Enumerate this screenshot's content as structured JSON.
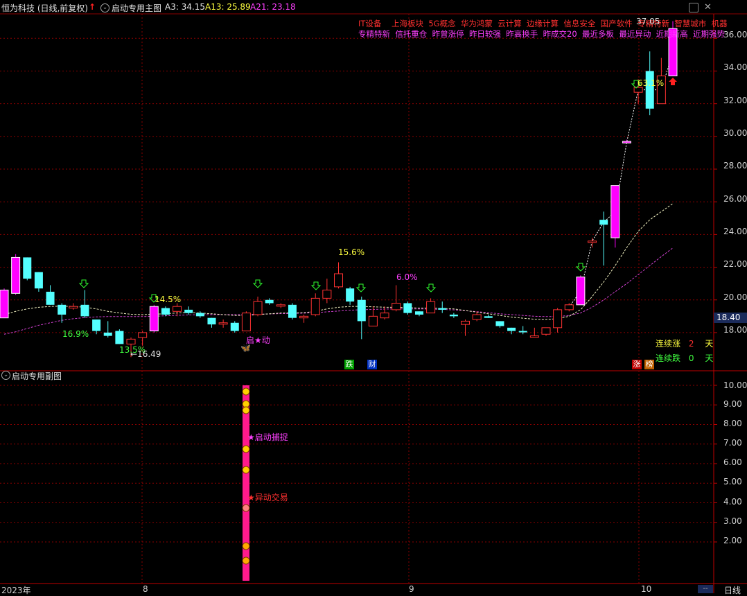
{
  "header": {
    "stock_title": "恒为科技 (日线,前复权)",
    "main_indicator": "启动专用主图",
    "a3_label": "A3: 34.15",
    "a13_label": "A13: 25.89",
    "a21_label": "A21: 23.18",
    "up_arrow": "↑",
    "collapse_glyph": "⌄"
  },
  "concept_tags": {
    "row1": [
      "IT设备",
      "上海板块",
      "5G概念",
      "华为鸿蒙",
      "云计算",
      "边缘计算",
      "信息安全",
      "国产软件",
      "专精特新",
      "智慧城市",
      "机器"
    ],
    "row2": [
      "专精特新",
      "信托重仓",
      "昨曾涨停",
      "昨日较强",
      "昨高换手",
      "昨成交20",
      "最近多板",
      "最近异动",
      "近期新高",
      "近期强势"
    ]
  },
  "chart_annotations": {
    "high_label": "37.05",
    "pct_labels": [
      "16.9%",
      "13.5%",
      "14.5%",
      "15.6%",
      "6.0%",
      "63.1%"
    ],
    "low_label": "←16.49",
    "start_label": "启★动",
    "die_label": "跌",
    "cai_label": "财",
    "zhang_label": "涨",
    "bang_label": "榜",
    "price_badge": "18.40"
  },
  "streak": {
    "up_label": "连续涨",
    "up_value": "2",
    "down_label": "连续跌",
    "down_value": "0",
    "unit": "天"
  },
  "sub_panel": {
    "title": "启动专用副图",
    "signal1": "★启动捕捉",
    "signal2": "★异动交易"
  },
  "axes": {
    "main_y_ticks": [
      "36.00",
      "34.00",
      "32.00",
      "30.00",
      "28.00",
      "26.00",
      "24.00",
      "22.00",
      "20.00",
      "18.00"
    ],
    "sub_y_ticks": [
      "10.00",
      "9.00",
      "8.00",
      "7.00",
      "6.00",
      "5.00",
      "4.00",
      "3.00",
      "2.00"
    ],
    "x_ticks": [
      "2023年",
      "8",
      "9",
      "10"
    ],
    "period_label": "日线",
    "dash_label": "--"
  },
  "colors": {
    "up": "#ff3232",
    "down": "#54ffff",
    "magenta": "#ff00ff",
    "ma_white": "#ffffff",
    "ma_pink": "#d040d0",
    "grid": "#8b0000",
    "yellow": "#ffff00",
    "green": "#00ff00",
    "bar_pink": "#ff1a8c"
  },
  "chart_data": {
    "type": "candlestick",
    "title": "恒为科技 (日线,前复权)",
    "ylim": [
      16.6,
      37.3
    ],
    "candles": [
      {
        "o": 18.9,
        "h": 20.7,
        "l": 18.9,
        "c": 20.6,
        "k": "m"
      },
      {
        "o": 20.4,
        "h": 22.8,
        "l": 20.3,
        "c": 22.6,
        "k": "m"
      },
      {
        "o": 22.6,
        "h": 22.6,
        "l": 21.2,
        "c": 21.3,
        "k": "d"
      },
      {
        "o": 21.7,
        "h": 21.7,
        "l": 20.5,
        "c": 20.7,
        "k": "d"
      },
      {
        "o": 20.5,
        "h": 20.9,
        "l": 19.7,
        "c": 19.7,
        "k": "d"
      },
      {
        "o": 19.7,
        "h": 19.8,
        "l": 18.6,
        "c": 19.1,
        "k": "d"
      },
      {
        "o": 19.6,
        "h": 19.8,
        "l": 19.4,
        "c": 19.5,
        "k": "u"
      },
      {
        "o": 19.7,
        "h": 20.6,
        "l": 18.9,
        "c": 19.0,
        "k": "d"
      },
      {
        "o": 18.8,
        "h": 18.8,
        "l": 17.9,
        "c": 18.1,
        "k": "d"
      },
      {
        "o": 18.0,
        "h": 18.7,
        "l": 17.7,
        "c": 17.8,
        "k": "d"
      },
      {
        "o": 18.1,
        "h": 18.2,
        "l": 17.3,
        "c": 17.3,
        "k": "d"
      },
      {
        "o": 17.3,
        "h": 17.7,
        "l": 16.5,
        "c": 17.6,
        "k": "u"
      },
      {
        "o": 17.7,
        "h": 18.1,
        "l": 17.2,
        "c": 18.0,
        "k": "u"
      },
      {
        "o": 18.1,
        "h": 19.7,
        "l": 18.0,
        "c": 19.6,
        "k": "m"
      },
      {
        "o": 19.5,
        "h": 19.6,
        "l": 19.0,
        "c": 19.1,
        "k": "d"
      },
      {
        "o": 19.3,
        "h": 19.8,
        "l": 19.0,
        "c": 19.6,
        "k": "u"
      },
      {
        "o": 19.4,
        "h": 19.6,
        "l": 19.1,
        "c": 19.2,
        "k": "d"
      },
      {
        "o": 19.2,
        "h": 19.3,
        "l": 18.9,
        "c": 19.0,
        "k": "d"
      },
      {
        "o": 18.9,
        "h": 18.9,
        "l": 18.3,
        "c": 18.5,
        "k": "d"
      },
      {
        "o": 18.6,
        "h": 18.8,
        "l": 18.3,
        "c": 18.6,
        "k": "u"
      },
      {
        "o": 18.6,
        "h": 18.7,
        "l": 18.0,
        "c": 18.1,
        "k": "d"
      },
      {
        "o": 18.1,
        "h": 19.3,
        "l": 18.1,
        "c": 19.2,
        "k": "u"
      },
      {
        "o": 19.1,
        "h": 20.2,
        "l": 19.0,
        "c": 19.9,
        "k": "u"
      },
      {
        "o": 20.0,
        "h": 20.1,
        "l": 19.7,
        "c": 19.8,
        "k": "d"
      },
      {
        "o": 19.7,
        "h": 19.8,
        "l": 19.5,
        "c": 19.7,
        "k": "u"
      },
      {
        "o": 19.7,
        "h": 19.8,
        "l": 18.8,
        "c": 18.9,
        "k": "d"
      },
      {
        "o": 18.9,
        "h": 19.1,
        "l": 18.6,
        "c": 19.0,
        "k": "u"
      },
      {
        "o": 19.1,
        "h": 20.4,
        "l": 19.0,
        "c": 20.1,
        "k": "u"
      },
      {
        "o": 20.1,
        "h": 21.3,
        "l": 19.8,
        "c": 20.6,
        "k": "u"
      },
      {
        "o": 20.8,
        "h": 22.3,
        "l": 20.7,
        "c": 21.6,
        "k": "u"
      },
      {
        "o": 20.7,
        "h": 20.8,
        "l": 19.7,
        "c": 19.9,
        "k": "d"
      },
      {
        "o": 20.0,
        "h": 20.2,
        "l": 17.6,
        "c": 18.7,
        "k": "d"
      },
      {
        "o": 18.4,
        "h": 19.6,
        "l": 18.4,
        "c": 19.0,
        "k": "u"
      },
      {
        "o": 18.9,
        "h": 19.6,
        "l": 18.8,
        "c": 19.2,
        "k": "u"
      },
      {
        "o": 19.4,
        "h": 20.9,
        "l": 19.3,
        "c": 19.8,
        "k": "u"
      },
      {
        "o": 19.8,
        "h": 19.9,
        "l": 19.1,
        "c": 19.2,
        "k": "d"
      },
      {
        "o": 19.3,
        "h": 19.3,
        "l": 19.0,
        "c": 19.1,
        "k": "d"
      },
      {
        "o": 19.2,
        "h": 20.1,
        "l": 19.2,
        "c": 19.9,
        "k": "u"
      },
      {
        "o": 19.4,
        "h": 19.9,
        "l": 19.2,
        "c": 19.5,
        "k": "d"
      },
      {
        "o": 19.1,
        "h": 19.2,
        "l": 18.9,
        "c": 19.0,
        "k": "d"
      },
      {
        "o": 18.5,
        "h": 18.8,
        "l": 17.8,
        "c": 18.7,
        "k": "u"
      },
      {
        "o": 18.8,
        "h": 19.3,
        "l": 18.7,
        "c": 19.1,
        "k": "u"
      },
      {
        "o": 19.0,
        "h": 19.1,
        "l": 18.9,
        "c": 18.9,
        "k": "d"
      },
      {
        "o": 18.7,
        "h": 18.7,
        "l": 18.3,
        "c": 18.4,
        "k": "d"
      },
      {
        "o": 18.3,
        "h": 18.3,
        "l": 17.9,
        "c": 18.1,
        "k": "d"
      },
      {
        "o": 18.1,
        "h": 18.4,
        "l": 17.9,
        "c": 18.1,
        "k": "d"
      },
      {
        "o": 17.8,
        "h": 18.3,
        "l": 17.7,
        "c": 17.8,
        "k": "u"
      },
      {
        "o": 17.9,
        "h": 18.3,
        "l": 17.8,
        "c": 18.3,
        "k": "u"
      },
      {
        "o": 18.3,
        "h": 19.5,
        "l": 18.0,
        "c": 19.4,
        "k": "u"
      },
      {
        "o": 19.4,
        "h": 19.8,
        "l": 19.3,
        "c": 19.7,
        "k": "u"
      },
      {
        "o": 19.7,
        "h": 21.5,
        "l": 19.7,
        "c": 21.4,
        "k": "m"
      },
      {
        "o": 23.6,
        "h": 23.8,
        "l": 23.2,
        "c": 23.6,
        "k": "u"
      },
      {
        "o": 24.6,
        "h": 25.4,
        "l": 22.1,
        "c": 24.9,
        "k": "d"
      },
      {
        "o": 23.8,
        "h": 27.0,
        "l": 23.2,
        "c": 27.0,
        "k": "m"
      },
      {
        "o": 29.6,
        "h": 29.8,
        "l": 29.6,
        "c": 29.7,
        "k": "m"
      },
      {
        "o": 32.7,
        "h": 33.5,
        "l": 32.0,
        "c": 33.0,
        "k": "u"
      },
      {
        "o": 34.0,
        "h": 35.2,
        "l": 31.3,
        "c": 31.7,
        "k": "d"
      },
      {
        "o": 32.0,
        "h": 34.8,
        "l": 32.0,
        "c": 33.7,
        "k": "u"
      },
      {
        "o": 33.7,
        "h": 37.05,
        "l": 33.7,
        "c": 36.6,
        "k": "m"
      }
    ],
    "ma_white": [
      19.1,
      19.3,
      19.45,
      19.55,
      19.6,
      19.62,
      19.6,
      19.55,
      19.45,
      19.3,
      19.2,
      19.12,
      19.1,
      19.12,
      19.16,
      19.2,
      19.22,
      19.2,
      19.15,
      19.1,
      19.05,
      19.05,
      19.1,
      19.15,
      19.2,
      19.2,
      19.22,
      19.3,
      19.45,
      19.55,
      19.6,
      19.6,
      19.58,
      19.55,
      19.55,
      19.53,
      19.5,
      19.5,
      19.48,
      19.45,
      19.35,
      19.25,
      19.15,
      19.05,
      18.95,
      18.88,
      18.82,
      18.8,
      18.85,
      19.0,
      19.4,
      20.2,
      21.1,
      22.1,
      23.2,
      24.2,
      24.9,
      25.4,
      25.89
    ],
    "ma_pink": [
      17.9,
      18.05,
      18.25,
      18.45,
      18.6,
      18.75,
      18.85,
      18.92,
      18.96,
      18.98,
      18.98,
      18.98,
      18.98,
      19.0,
      19.03,
      19.06,
      19.08,
      19.1,
      19.1,
      19.1,
      19.1,
      19.1,
      19.12,
      19.14,
      19.16,
      19.17,
      19.19,
      19.22,
      19.27,
      19.32,
      19.37,
      19.4,
      19.42,
      19.44,
      19.45,
      19.45,
      19.45,
      19.44,
      19.42,
      19.39,
      19.34,
      19.28,
      19.22,
      19.15,
      19.1,
      19.05,
      19.0,
      18.98,
      18.98,
      19.05,
      19.2,
      19.55,
      20.0,
      20.5,
      21.0,
      21.55,
      22.1,
      22.65,
      23.18
    ]
  }
}
